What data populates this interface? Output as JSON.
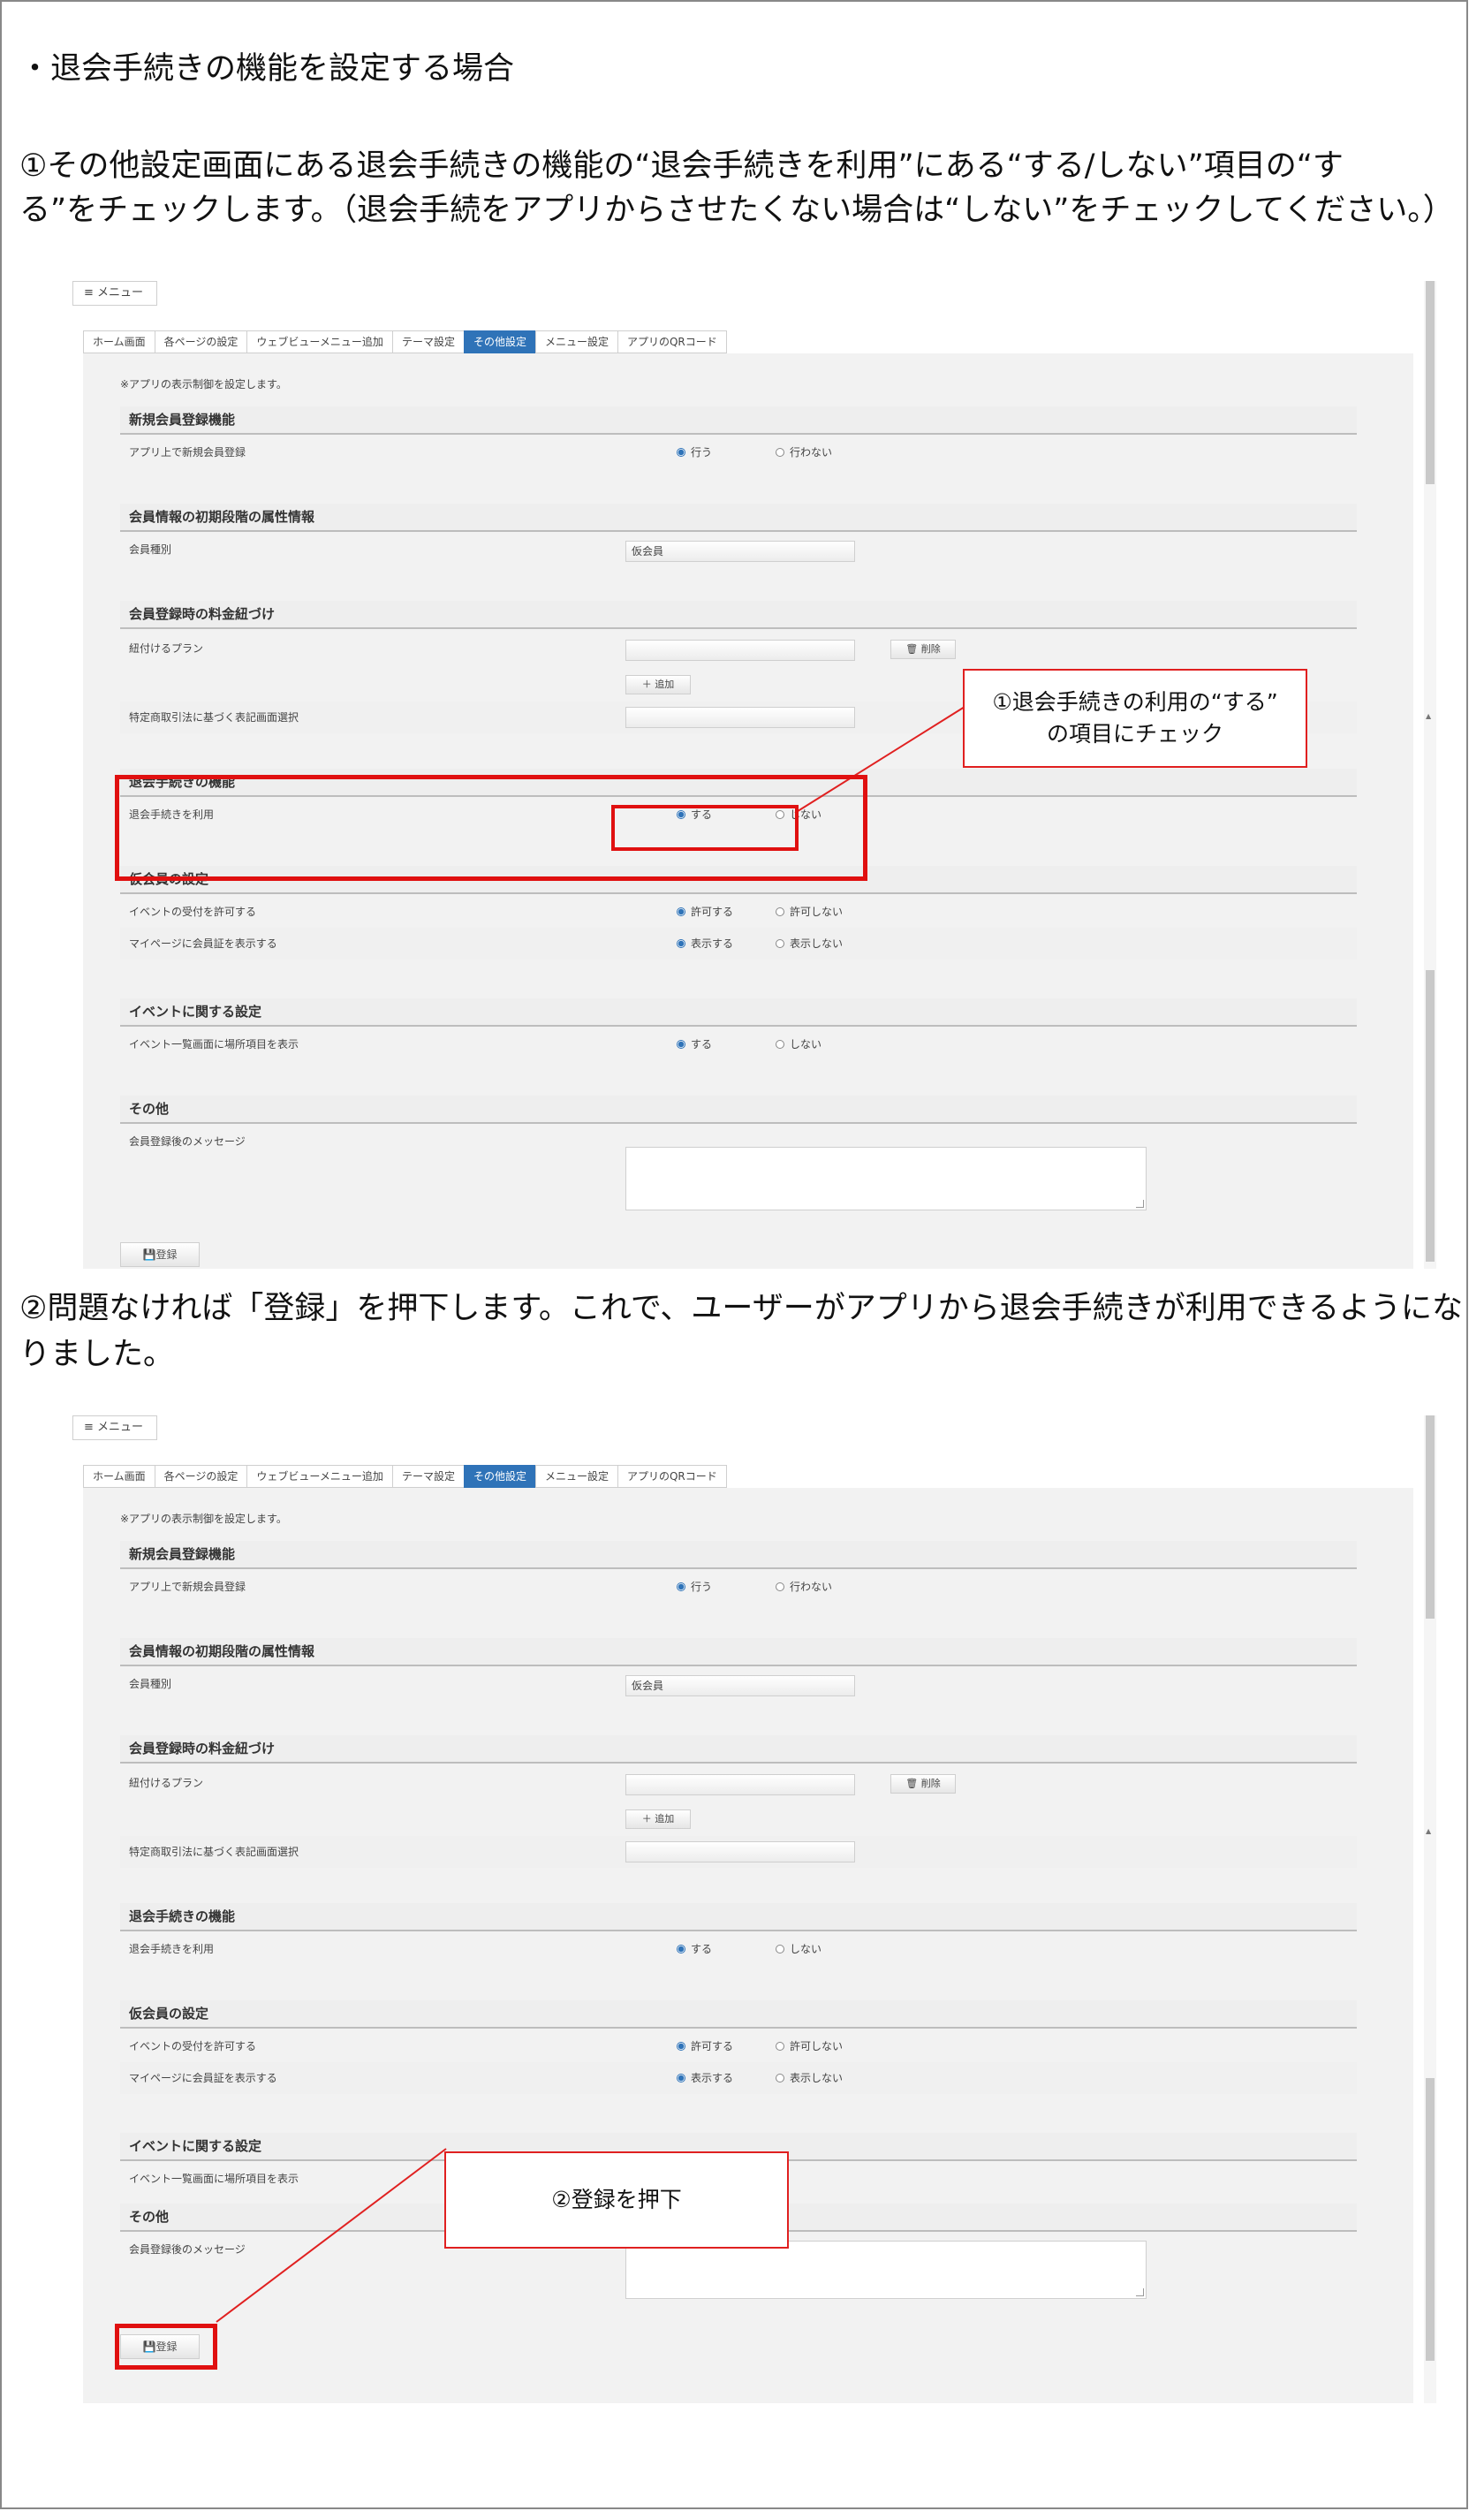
{
  "heading": "・退会手続きの機能を設定する場合",
  "step1": {
    "line1": "①その他設定画面にある退会手続きの機能の“退会手続きを利用”にある“する/しない”項目の“す",
    "line2": "る”をチェックします。（退会手続をアプリからさせたくない場合は“しない”をチェックしてください。）",
    "callout_line1": "①退会手続きの利用の“する”",
    "callout_line2": "の項目にチェック"
  },
  "step2": {
    "line1": "②問題なければ「登録」を押下します。これで、ユーザーがアプリから退会手続きが利用できるようにな",
    "line2": "りました。",
    "callout": "②登録を押下"
  },
  "ui": {
    "menu_label": "≡ メニュー",
    "tabs": [
      "ホーム画面",
      "各ページの設定",
      "ウェブビューメニュー追加",
      "テーマ設定",
      "その他設定",
      "メニュー設定",
      "アプリのQRコード"
    ],
    "active_tab": 4,
    "note": "※アプリの表示制御を設定します。",
    "sections": {
      "new_member": "新規会員登録機能",
      "initial_attr": "会員情報の初期段階の属性情報",
      "fee": "会員登録時の料金紐づけ",
      "withdraw": "退会手続きの機能",
      "provisional": "仮会員の設定",
      "event": "イベントに関する設定",
      "other": "その他"
    },
    "rows": {
      "app_signup": "アプリ上で新規会員登録",
      "member_type": "会員種別",
      "link_plan": "紐付けるプラン",
      "tokusho": "特定商取引法に基づく表記画面選択",
      "use_withdraw": "退会手続きを利用",
      "allow_event": "イベントの受付を許可する",
      "show_card": "マイページに会員証を表示する",
      "show_place": "イベント一覧画面に場所項目を表示",
      "after_msg": "会員登録後のメッセージ"
    },
    "options": {
      "do": "行う",
      "dont": "行わない",
      "yes": "する",
      "no": "しない",
      "allow": "許可する",
      "disallow": "許可しない",
      "show": "表示する",
      "hide": "表示しない"
    },
    "member_type_value": "仮会員",
    "delete_btn": "🗑 削除",
    "add_btn": "＋ 追加",
    "save_btn": "💾登録"
  }
}
